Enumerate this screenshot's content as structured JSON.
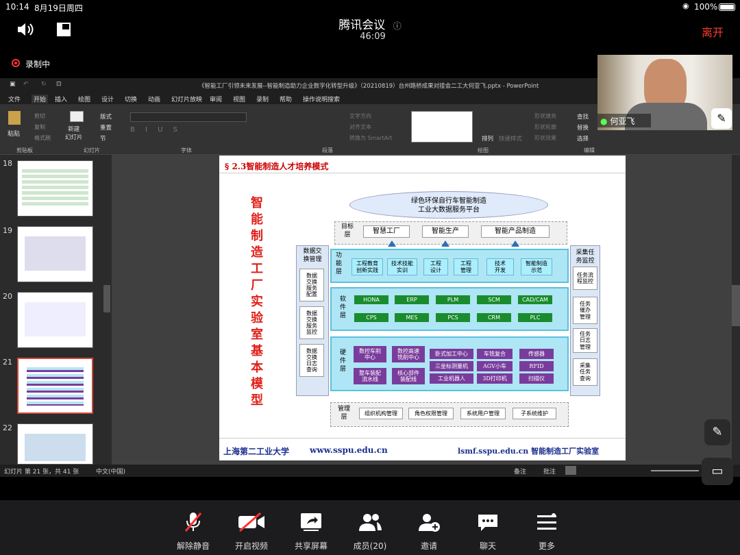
{
  "status": {
    "time": "10:14",
    "date": "8月19日周四",
    "battery": "100%"
  },
  "meeting": {
    "title": "腾讯会议",
    "duration": "46:09",
    "leave": "离开",
    "recording": "录制中"
  },
  "participant": {
    "name": "何亚飞"
  },
  "ppt": {
    "doc_title": "《智能工厂引领未来发展--智能制造助力企业数字化转型升级》（20210819）台州路桥成果对接会二工大何亚飞.pptx  -  PowerPoint",
    "menu": [
      "文件",
      "开始",
      "插入",
      "绘图",
      "设计",
      "切换",
      "动画",
      "幻灯片放映",
      "审阅",
      "视图",
      "录制",
      "帮助",
      "操作说明搜索"
    ],
    "ribbon_groups": [
      "剪贴板",
      "幻灯片",
      "字体",
      "段落",
      "绘图",
      "编辑"
    ],
    "ribbon_items": {
      "paste": "粘贴",
      "cut": "剪切",
      "copy": "复制",
      "format": "格式刷",
      "new_slide": "新建\n幻灯片",
      "layout": "版式",
      "reset": "重置",
      "section": "节",
      "text_dir": "文字方向",
      "align_text": "对齐文本",
      "smartart": "转换为 SmartArt",
      "arrange": "排列",
      "quick_style": "快速样式",
      "fill": "形状填充",
      "outline": "形状轮廓",
      "effect": "形状效果",
      "find": "查找",
      "replace": "替换",
      "select": "选择"
    },
    "thumbs": [
      "18",
      "19",
      "20",
      "21",
      "22"
    ],
    "status_left": "幻灯片 第 21 张，共 41 张",
    "lang": "中文(中国)",
    "notes": "备注",
    "comments": "批注"
  },
  "slide": {
    "header": "§ 2.3智能制造人才培养模式",
    "vertical_title": "智能制造工厂实验室基本模型",
    "cloud": "绿色环保自行车智能制造\n工业大数据服务平台",
    "target_layer": "目标\n层",
    "targets": [
      "智慧工厂",
      "智能生产",
      "智能产品制造"
    ],
    "left_header": "数据交\n换管理",
    "left_items": [
      "数据\n交换\n服务\n配置",
      "数据\n交换\n服务\n监控",
      "数据\n交换\n日志\n查询"
    ],
    "right_header": "采集任\n务监控",
    "right_items": [
      "任务流\n程监控",
      "任务\n催办\n管理",
      "任务\n日志\n管理",
      "采集\n任务\n查询"
    ],
    "func_layer": "功\n能\n层",
    "func_items": [
      "工程教育\n创新实践",
      "技术技能\n实训",
      "工程\n设计",
      "工程\n管理",
      "技术\n开发",
      "智能制造\n示范"
    ],
    "soft_layer": "软\n件\n层",
    "soft_items": [
      "HONA",
      "ERP",
      "PLM",
      "SCM",
      "CAD/CAM",
      "CPS",
      "MES",
      "PCS",
      "CRM",
      "PLC"
    ],
    "hard_layer": "硬\n件\n层",
    "hard_items": [
      "数控车削\n中心",
      "数控高速\n铣削中心",
      "卧式加工中心",
      "车铣复合",
      "传感器",
      "整车装配\n流水线",
      "核心部件\n装配线",
      "三坐标测量机",
      "AGV小车",
      "RFID",
      "工业机器人",
      "3D打印机",
      "扫描仪"
    ],
    "mgmt_layer": "管理\n层",
    "mgmt_items": [
      "组织机构管理",
      "角色权限管理",
      "系统用户管理",
      "子系统维护"
    ],
    "footer_left": "上海第二工业大学",
    "footer_url": "www.sspu.edu.cn",
    "footer_right": "lsmf.sspu.edu.cn 智能制造工厂实验室"
  },
  "toolbar": [
    {
      "label": "解除静音",
      "icon": "mic-off-icon"
    },
    {
      "label": "开启视频",
      "icon": "video-off-icon"
    },
    {
      "label": "共享屏幕",
      "icon": "share-screen-icon"
    },
    {
      "label": "成员(20)",
      "icon": "members-icon"
    },
    {
      "label": "邀请",
      "icon": "invite-icon"
    },
    {
      "label": "聊天",
      "icon": "chat-icon"
    },
    {
      "label": "更多",
      "icon": "more-icon"
    }
  ]
}
